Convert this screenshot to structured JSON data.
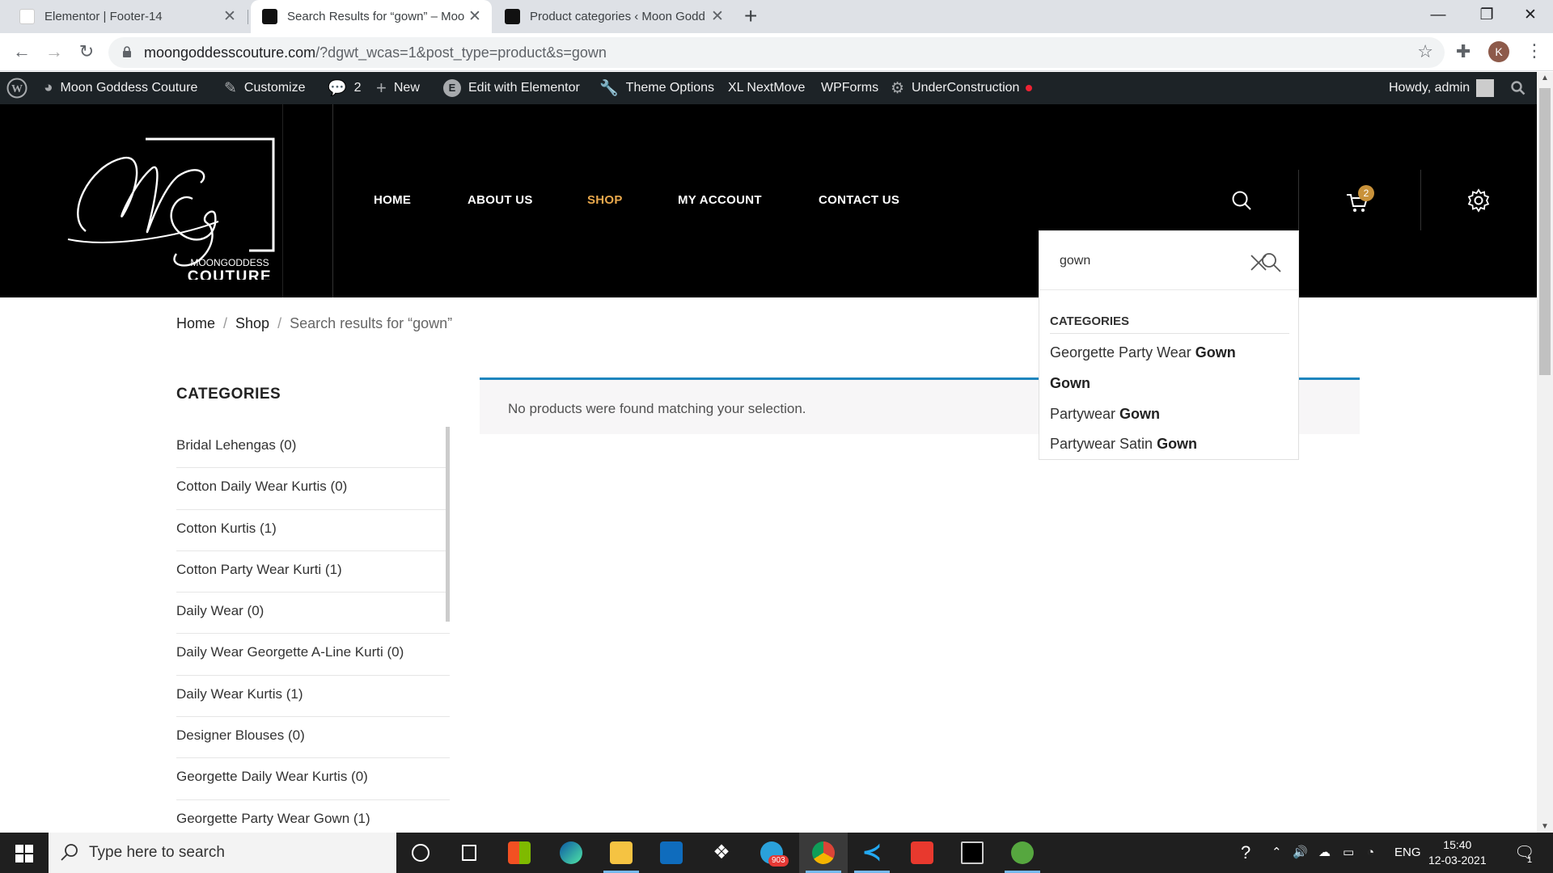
{
  "browser": {
    "tabs": [
      {
        "title": "Elementor | Footer-14",
        "active": false
      },
      {
        "title": "Search Results for “gown” – Moo",
        "active": true
      },
      {
        "title": "Product categories ‹ Moon Godd",
        "active": false
      }
    ],
    "url_domain": "moongoddesscouture.com",
    "url_rest": "/?dgwt_wcas=1&post_type=product&s=gown",
    "profile_initial": "K"
  },
  "adminbar": {
    "site_name": "Moon Goddess Couture",
    "customize": "Customize",
    "comments_count": "2",
    "new": "New",
    "edit_elementor": "Edit with Elementor",
    "theme_options": "Theme Options",
    "xl_nextmove": "XL NextMove",
    "wpforms": "WPForms",
    "under_construction": "UnderConstruction",
    "howdy": "Howdy, admin"
  },
  "logo": {
    "line1": "MOONGODDESS",
    "line2": "COUTURE"
  },
  "nav": {
    "home": "HOME",
    "about": "ABOUT US",
    "shop": "SHOP",
    "account": "MY ACCOUNT",
    "contact": "CONTACT US"
  },
  "cart_count": "2",
  "search": {
    "query": "gown",
    "suggestions_heading": "CATEGORIES",
    "suggestions": [
      {
        "prefix": "Georgette Party Wear ",
        "match": "Gown"
      },
      {
        "prefix": "",
        "match": "Gown"
      },
      {
        "prefix": "Partywear ",
        "match": "Gown"
      },
      {
        "prefix": "Partywear Satin ",
        "match": "Gown"
      }
    ]
  },
  "breadcrumb": {
    "home": "Home",
    "shop": "Shop",
    "current": "Search results for “gown”",
    "sep": "/"
  },
  "sidebar": {
    "title": "CATEGORIES",
    "categories": [
      "Bridal Lehengas (0)",
      "Cotton Daily Wear Kurtis (0)",
      "Cotton Kurtis (1)",
      "Cotton Party Wear Kurti (1)",
      "Daily Wear (0)",
      "Daily Wear Georgette A-Line Kurti (0)",
      "Daily Wear Kurtis (1)",
      "Designer Blouses (0)",
      "Georgette Daily Wear Kurtis (0)",
      "Georgette Party Wear Gown (1)"
    ]
  },
  "notice": "No products were found matching your selection.",
  "taskbar": {
    "search_placeholder": "Type here to search",
    "telegram_badge": "903",
    "lang": "ENG",
    "time": "15:40",
    "date": "12-03-2021",
    "notif_count": "1"
  }
}
